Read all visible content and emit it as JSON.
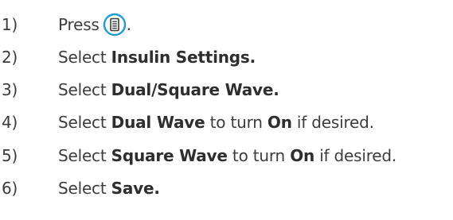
{
  "steps": [
    {
      "num": "1)",
      "pre": "Press",
      "icon": "menu-button-icon",
      "post": "."
    },
    {
      "num": "2)",
      "pre": "Select ",
      "bold1": "Insulin Settings."
    },
    {
      "num": "3)",
      "pre": "Select ",
      "bold1": "Dual/Square Wave."
    },
    {
      "num": "4)",
      "pre": "Select ",
      "bold1": "Dual Wave",
      "mid": " to turn ",
      "bold2": "On",
      "post": " if desired."
    },
    {
      "num": "5)",
      "pre": "Select ",
      "bold1": "Square Wave",
      "mid": " to turn ",
      "bold2": "On",
      "post": " if desired."
    },
    {
      "num": "6)",
      "pre": "Select ",
      "bold1": "Save."
    }
  ],
  "colors": {
    "text": "#3c3c3c",
    "icon_ring": "#1f9bd6"
  }
}
